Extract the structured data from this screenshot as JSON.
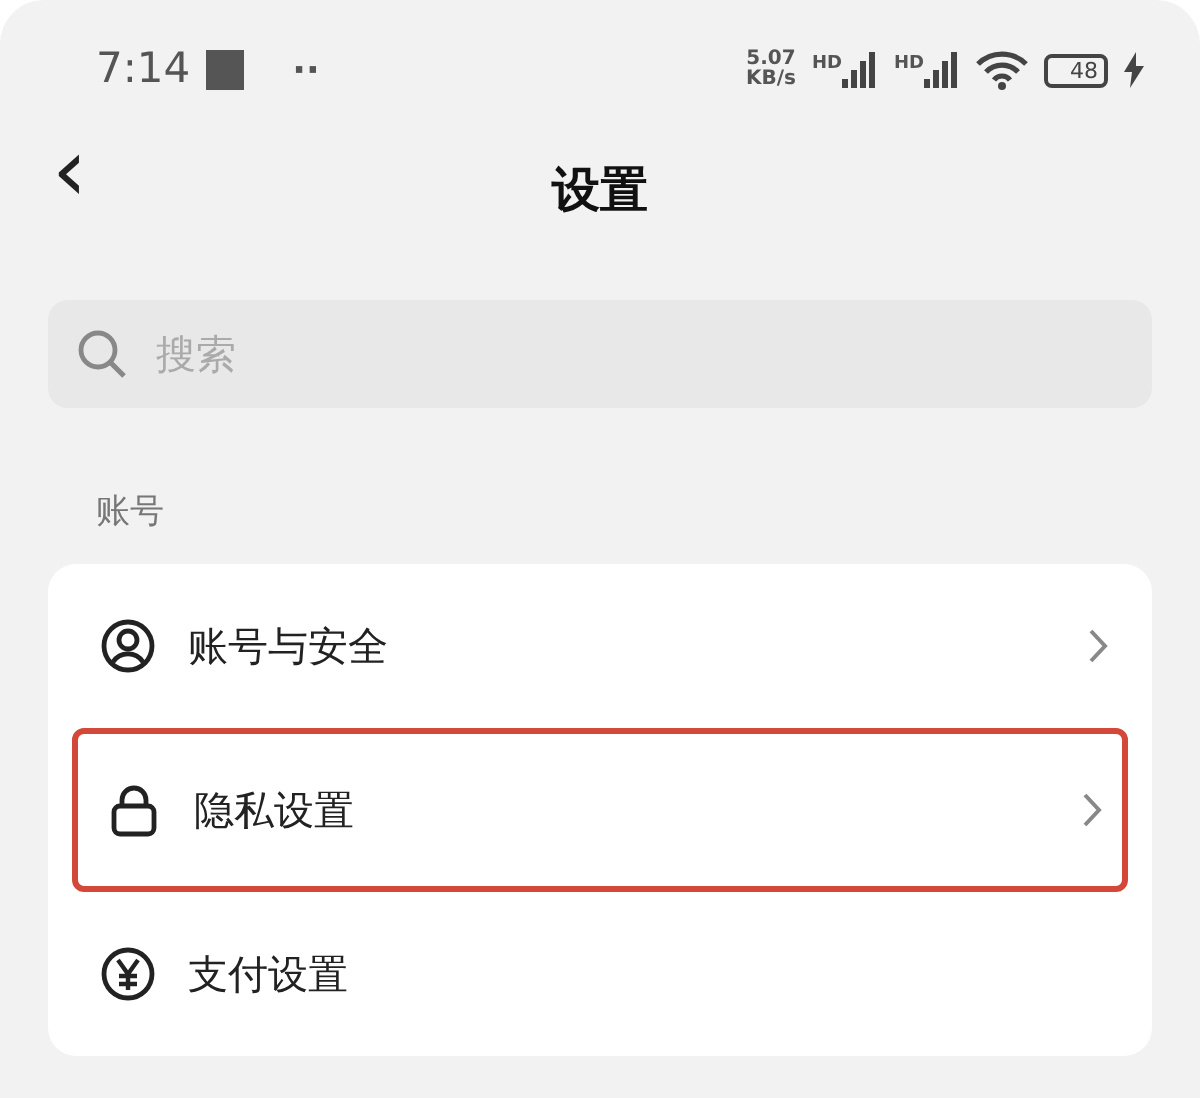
{
  "status_bar": {
    "time": "7:14",
    "notification_dots": "··",
    "net_speed": "5.07",
    "net_unit": "KB/s",
    "signals": [
      {
        "label": "HD"
      },
      {
        "label": "HD"
      }
    ],
    "battery": "48",
    "charging": true
  },
  "header": {
    "back": "‹",
    "title": "设置"
  },
  "search": {
    "placeholder": "搜索"
  },
  "section": {
    "title": "账号",
    "items": [
      {
        "kind": "person",
        "label": "账号与安全",
        "chevron": true,
        "highlighted": false
      },
      {
        "kind": "lock",
        "label": "隐私设置",
        "chevron": true,
        "highlighted": true
      },
      {
        "kind": "yen",
        "label": "支付设置",
        "chevron": false,
        "highlighted": false
      }
    ]
  }
}
